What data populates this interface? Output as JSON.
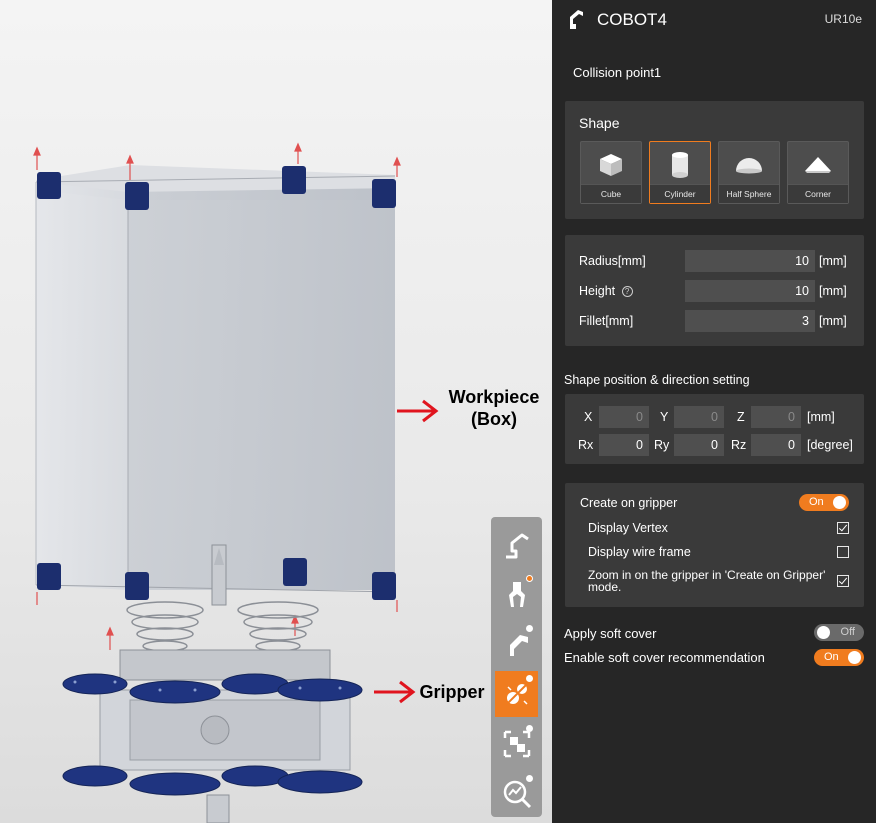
{
  "app": {
    "title": "COBOT4",
    "model": "UR10e"
  },
  "collision": {
    "title": "Collision point1"
  },
  "shape": {
    "section_label": "Shape",
    "options": [
      {
        "label": "Cube",
        "icon": "cube-icon",
        "selected": false
      },
      {
        "label": "Cylinder",
        "icon": "cylinder-icon",
        "selected": true
      },
      {
        "label": "Half Sphere",
        "icon": "half-sphere-icon",
        "selected": false
      },
      {
        "label": "Corner",
        "icon": "corner-icon",
        "selected": false
      }
    ]
  },
  "dimensions": {
    "radius": {
      "label": "Radius[mm]",
      "value": "10",
      "unit": "[mm]"
    },
    "height": {
      "label": "Height",
      "value": "10",
      "unit": "[mm]"
    },
    "fillet": {
      "label": "Fillet[mm]",
      "value": "3",
      "unit": "[mm]"
    }
  },
  "position": {
    "section_label": "Shape position & direction setting",
    "x": {
      "label": "X",
      "value": "0"
    },
    "y": {
      "label": "Y",
      "value": "0"
    },
    "z": {
      "label": "Z",
      "value": "0"
    },
    "pos_unit": "[mm]",
    "rx": {
      "label": "Rx",
      "value": "0"
    },
    "ry": {
      "label": "Ry",
      "value": "0"
    },
    "rz": {
      "label": "Rz",
      "value": "0"
    },
    "rot_unit": "[degree]"
  },
  "gripper_options": {
    "create_on_gripper": {
      "label": "Create on gripper",
      "state": "On"
    },
    "display_vertex": {
      "label": "Display Vertex",
      "checked": true
    },
    "display_wire_frame": {
      "label": "Display wire frame",
      "checked": false
    },
    "zoom_gripper": {
      "label_line1": "Zoom in on the gripper in 'Create on Gripper'",
      "label_line2": "mode.",
      "checked": true
    }
  },
  "soft_cover": {
    "apply": {
      "label": "Apply soft cover",
      "state": "Off"
    },
    "recommend": {
      "label": "Enable soft cover recommendation",
      "state": "On"
    }
  },
  "annotations": {
    "workpiece_line1": "Workpiece",
    "workpiece_line2": "(Box)",
    "gripper": "Gripper"
  },
  "toolbar": [
    {
      "icon": "robot-arm-icon",
      "active": false,
      "dot": false
    },
    {
      "icon": "gripper-icon",
      "active": false,
      "dot": true
    },
    {
      "icon": "robot-pose-icon",
      "active": false,
      "dot": true
    },
    {
      "icon": "collision-point-icon",
      "active": true,
      "dot": true
    },
    {
      "icon": "bounding-box-icon",
      "active": false,
      "dot": true
    },
    {
      "icon": "inspection-icon",
      "active": false,
      "dot": true
    }
  ],
  "colors": {
    "accent": "#f07c1f",
    "panel_bg": "#262626",
    "section_bg": "#3a3a3a",
    "vertex_blue": "#1c2e6e"
  }
}
